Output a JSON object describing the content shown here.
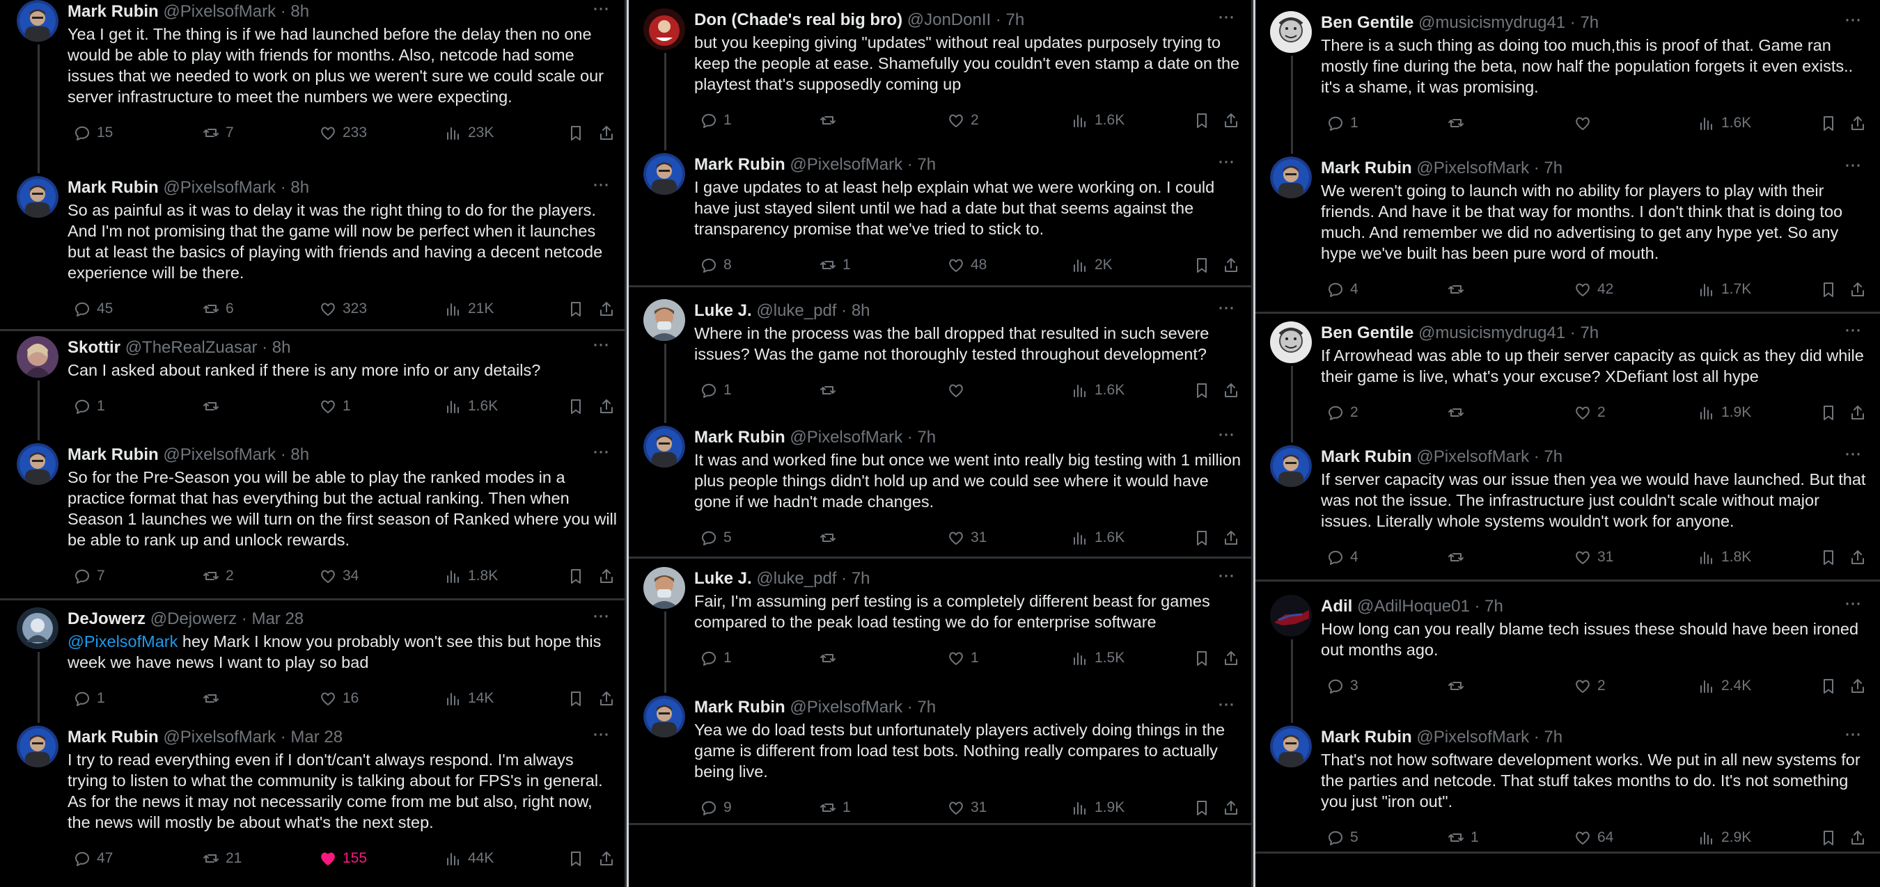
{
  "columns": [
    {
      "tweets": [
        {
          "name": "Mark Rubin",
          "handle": "@PixelsofMark",
          "time": "8h",
          "avatar": "mark",
          "lines": [
            "Yea I get it. The thing is if we had launched before the delay then no one",
            "would be able to play with friends for months. Also, netcode had some",
            "issues that we needed to work on plus we weren't sure we could scale our",
            "server infrastructure to meet the numbers we were expecting."
          ],
          "replies": "15",
          "reposts": "7",
          "likes": "233",
          "views": "23K"
        },
        {
          "name": "Mark Rubin",
          "handle": "@PixelsofMark",
          "time": "8h",
          "avatar": "mark",
          "lines": [
            "So as painful as it was to delay it was the right thing to do for the players.",
            "And I'm not promising that the game will now be perfect when it launches",
            "but at least the basics of playing with friends and having a decent netcode",
            "experience will be there."
          ],
          "replies": "45",
          "reposts": "6",
          "likes": "323",
          "views": "21K"
        },
        {
          "name": "Skottir",
          "handle": "@TheRealZuasar",
          "time": "8h",
          "avatar": "skottir",
          "lines": [
            "Can I asked about ranked if there is any more info or any details?"
          ],
          "replies": "1",
          "reposts": "",
          "likes": "1",
          "views": "1.6K"
        },
        {
          "name": "Mark Rubin",
          "handle": "@PixelsofMark",
          "time": "8h",
          "avatar": "mark",
          "lines": [
            "So for the Pre-Season you will be able to play the ranked modes in a",
            "practice format that has everything but the actual ranking. Then when",
            "Season 1 launches we will turn on the first season of Ranked where you will",
            "be able to rank up and unlock rewards."
          ],
          "replies": "7",
          "reposts": "2",
          "likes": "34",
          "views": "1.8K"
        },
        {
          "name": "DeJowerz",
          "handle": "@Dejowerz",
          "time": "Mar 28",
          "avatar": "dejowerz",
          "mention": "@PixelsofMark",
          "lines": [
            " hey Mark I know you probably won't see this but hope this",
            "week we have news I want to play so bad"
          ],
          "replies": "1",
          "reposts": "",
          "likes": "16",
          "views": "14K"
        },
        {
          "name": "Mark Rubin",
          "handle": "@PixelsofMark",
          "time": "Mar 28",
          "avatar": "mark",
          "lines": [
            "I try to read everything even if I don't/can't always respond. I'm always",
            "trying to listen to what the community is talking about for FPS's in general.",
            "As for the news it may not necessarily come from me but also, right now,",
            "the news will mostly be about what's the next step."
          ],
          "replies": "47",
          "reposts": "21",
          "likes": "155",
          "views": "44K",
          "liked": true
        }
      ]
    },
    {
      "tweets": [
        {
          "name": "Don (Chade's real big bro)",
          "handle": "@JonDonII",
          "time": "7h",
          "avatar": "don",
          "lines": [
            "but you keeping giving \"updates\" without real updates purposely trying to",
            "keep the people at ease. Shamefully you couldn't even stamp a date on the",
            "playtest that's supposedly coming up"
          ],
          "replies": "1",
          "reposts": "",
          "likes": "2",
          "views": "1.6K"
        },
        {
          "name": "Mark Rubin",
          "handle": "@PixelsofMark",
          "time": "7h",
          "avatar": "mark",
          "lines": [
            "I gave updates to at least help explain what we were working on. I could",
            "have just stayed silent until we had a date but that seems against the",
            "transparency promise that we've tried to stick to."
          ],
          "replies": "8",
          "reposts": "1",
          "likes": "48",
          "views": "2K"
        },
        {
          "name": "Luke J.",
          "handle": "@luke_pdf",
          "time": "8h",
          "avatar": "luke",
          "lines": [
            "Where in the process was the ball dropped that resulted in such severe",
            "issues? Was the game not thoroughly tested throughout development?"
          ],
          "replies": "1",
          "reposts": "",
          "likes": "",
          "views": "1.6K"
        },
        {
          "name": "Mark Rubin",
          "handle": "@PixelsofMark",
          "time": "7h",
          "avatar": "mark",
          "lines": [
            "It was and worked fine but once we went into really big testing with 1 million",
            "plus people things didn't hold up and we could see where it would have",
            "gone if we hadn't made changes."
          ],
          "replies": "5",
          "reposts": "",
          "likes": "31",
          "views": "1.6K"
        },
        {
          "name": "Luke J.",
          "handle": "@luke_pdf",
          "time": "7h",
          "avatar": "luke",
          "lines": [
            "Fair, I'm assuming perf testing is a completely different beast for games",
            "compared to the peak load testing we do for enterprise software"
          ],
          "replies": "1",
          "reposts": "",
          "likes": "1",
          "views": "1.5K"
        },
        {
          "name": "Mark Rubin",
          "handle": "@PixelsofMark",
          "time": "7h",
          "avatar": "mark",
          "lines": [
            "Yea we do load tests but unfortunately players actively doing things in the",
            "game is different from load test bots. Nothing really compares to actually",
            "being live."
          ],
          "replies": "9",
          "reposts": "1",
          "likes": "31",
          "views": "1.9K"
        }
      ]
    },
    {
      "tweets": [
        {
          "name": "Ben Gentile",
          "handle": "@musicismydrug41",
          "time": "7h",
          "avatar": "ben",
          "lines": [
            "There is a such thing as doing too much,this is proof of that. Game ran",
            "mostly fine during the beta, now half the population forgets it even exists..",
            "it's a shame, it was promising."
          ],
          "replies": "1",
          "reposts": "",
          "likes": "",
          "views": "1.6K"
        },
        {
          "name": "Mark Rubin",
          "handle": "@PixelsofMark",
          "time": "7h",
          "avatar": "mark",
          "lines": [
            "We weren't going to launch with no ability for players to play with their",
            "friends. And have it be that way for months. I don't think that is doing too",
            "much. And remember we did no advertising to get any hype yet. So any",
            "hype we've built has been pure word of mouth."
          ],
          "replies": "4",
          "reposts": "",
          "likes": "42",
          "views": "1.7K"
        },
        {
          "name": "Ben Gentile",
          "handle": "@musicismydrug41",
          "time": "7h",
          "avatar": "ben",
          "lines": [
            "If Arrowhead was able to up their server capacity as quick as they did while",
            "their game is live, what's your excuse? XDefiant lost all hype"
          ],
          "replies": "2",
          "reposts": "",
          "likes": "2",
          "views": "1.9K"
        },
        {
          "name": "Mark Rubin",
          "handle": "@PixelsofMark",
          "time": "7h",
          "avatar": "mark",
          "lines": [
            "If server capacity was our issue then yea we would have launched. But that",
            "was not the issue. The infrastructure just couldn't scale without major",
            "issues. Literally whole systems wouldn't work for anyone."
          ],
          "replies": "4",
          "reposts": "",
          "likes": "31",
          "views": "1.8K"
        },
        {
          "name": "Adil",
          "handle": "@AdilHoque01",
          "time": "7h",
          "avatar": "adil",
          "lines": [
            "How long can you really blame tech issues these should have been ironed",
            "out months ago."
          ],
          "replies": "3",
          "reposts": "",
          "likes": "2",
          "views": "2.4K"
        },
        {
          "name": "Mark Rubin",
          "handle": "@PixelsofMark",
          "time": "7h",
          "avatar": "mark",
          "lines": [
            "That's not how software development works. We put in all new systems for",
            "the parties and netcode. That stuff takes months to do. It's not something",
            "you just \"iron out\"."
          ],
          "replies": "5",
          "reposts": "1",
          "likes": "64",
          "views": "2.9K"
        }
      ]
    }
  ],
  "colors": {
    "background": "#000000",
    "text": "#e7e9ea",
    "muted": "#71767b",
    "link": "#1d9bf0",
    "like_active": "#f91880",
    "divider": "#2f3336"
  }
}
